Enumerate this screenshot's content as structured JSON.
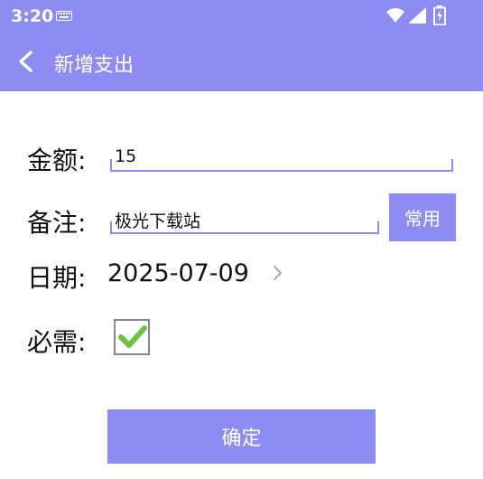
{
  "status": {
    "time": "3:20"
  },
  "app_bar": {
    "title": "新增支出"
  },
  "form": {
    "amount": {
      "label": "金额:",
      "value": "15"
    },
    "note": {
      "label": "备注:",
      "value": "极光下载站",
      "common_button": "常用"
    },
    "date": {
      "label": "日期:",
      "value": "2025-07-09"
    },
    "required": {
      "label": "必需:",
      "checked": true
    }
  },
  "confirm_button": "确定",
  "colors": {
    "accent": "#8c8cf2",
    "check": "#6ec23f"
  }
}
